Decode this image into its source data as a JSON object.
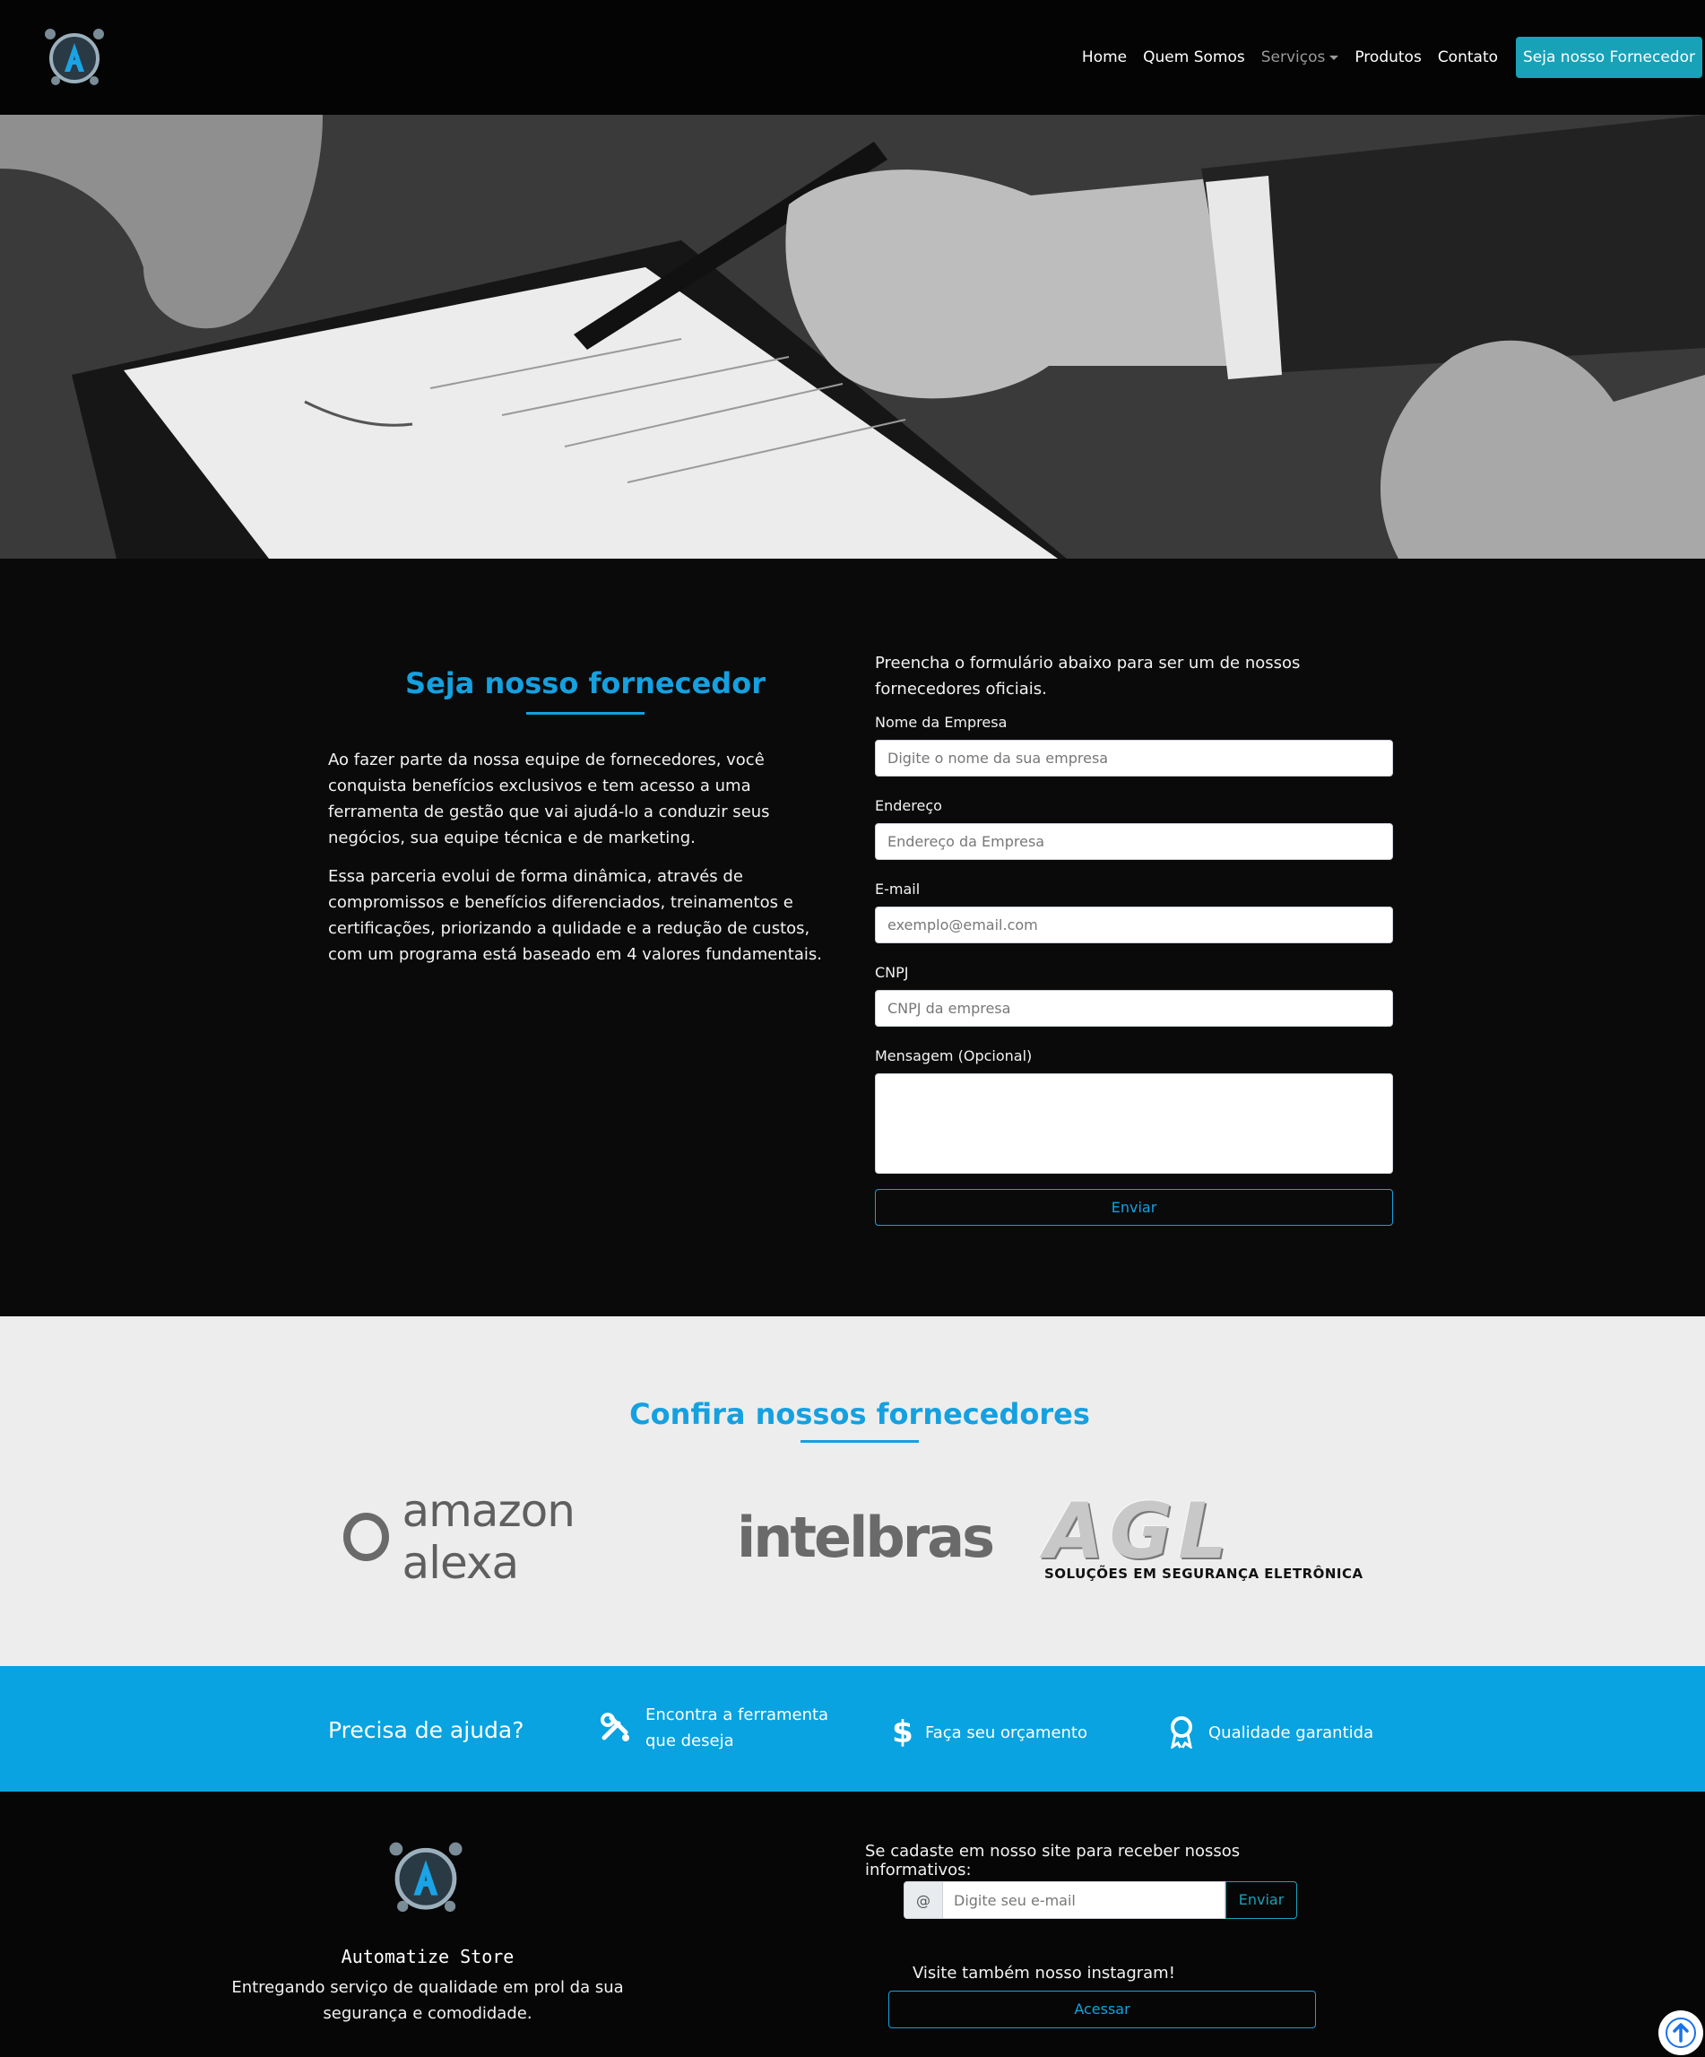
{
  "nav": {
    "items": [
      {
        "label": "Home"
      },
      {
        "label": "Quem Somos"
      },
      {
        "label": "Serviços"
      },
      {
        "label": "Produtos"
      },
      {
        "label": "Contato"
      }
    ],
    "cta": "Seja nosso Fornecedor",
    "logo_icon": "automatize-logo-icon",
    "cta_color": "#17a2b8"
  },
  "hero": {
    "image": "hands-signing-contract-photo"
  },
  "supplier": {
    "title": "Seja nosso fornecedor",
    "paragraphs": [
      "Ao fazer parte da nossa equipe de fornecedores, você conquista benefícios exclusivos e tem acesso a uma ferramenta de gestão que vai ajudá-lo a conduzir seus negócios, sua equipe técnica e de marketing.",
      "Essa parceria evolui de forma dinâmica, através de compromissos e benefícios diferenciados, treinamentos e certificações, priorizando a qulidade e a redução de custos, com um programa está baseado em 4 valores fundamentais."
    ],
    "accent_color": "#15a0e0"
  },
  "form": {
    "intro": "Preencha o formulário abaixo para ser um de nossos fornecedores oficiais.",
    "fields": [
      {
        "label": "Nome da Empresa",
        "placeholder": "Digite o nome da sua empresa",
        "value": ""
      },
      {
        "label": "Endereço",
        "placeholder": "Endereço da Empresa",
        "value": ""
      },
      {
        "label": "E-mail",
        "placeholder": "exemplo@email.com",
        "value": ""
      },
      {
        "label": "CNPJ",
        "placeholder": "CNPJ da empresa",
        "value": ""
      }
    ],
    "message_label": "Mensagem (Opcional)",
    "message_value": "",
    "submit": "Enviar"
  },
  "partners": {
    "title": "Confira nossos fornecedores",
    "logos": [
      {
        "name": "amazon alexa"
      },
      {
        "name": "intelbras"
      },
      {
        "name": "AGL",
        "subtitle": "SOLUÇÕES EM SEGURANÇA ELETRÔNICA"
      }
    ]
  },
  "help": {
    "title": "Precisa de ajuda?",
    "items": [
      {
        "icon": "tools-icon",
        "label_line1": "Encontra a ferramenta",
        "label_line2": "que deseja"
      },
      {
        "icon": "dollar-icon",
        "label_line1": "Faça seu orçamento",
        "label_line2": ""
      },
      {
        "icon": "award-icon",
        "label_line1": "Qualidade garantida",
        "label_line2": ""
      }
    ],
    "bg_color": "#08a3e0"
  },
  "footer": {
    "brand": "Automatize Store",
    "tagline": "Entregando serviço de qualidade em prol da sua segurança e comodidade.",
    "newsletter_text": "Se cadaste em nosso site para receber nossos informativos:",
    "newsletter_prefix": "@",
    "newsletter_placeholder": "Digite seu e-mail",
    "newsletter_value": "",
    "newsletter_button": "Enviar",
    "instagram_text": "Visite também nosso instagram!",
    "instagram_button": "Acessar",
    "back_to_top_icon": "arrow-up-icon"
  }
}
